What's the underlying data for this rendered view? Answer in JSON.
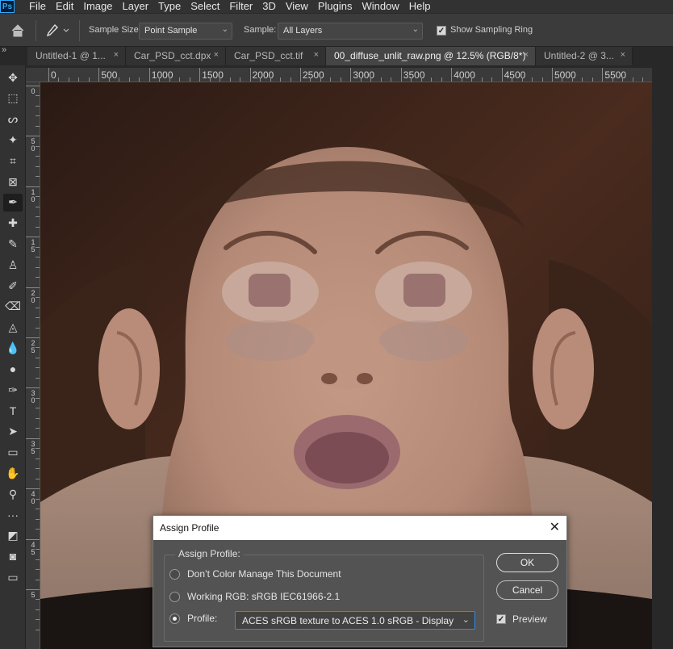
{
  "app": {
    "logo": "Ps"
  },
  "menu": [
    "File",
    "Edit",
    "Image",
    "Layer",
    "Type",
    "Select",
    "Filter",
    "3D",
    "View",
    "Plugins",
    "Window",
    "Help"
  ],
  "options_bar": {
    "home_icon": "home-icon",
    "tool_icon": "eyedropper-icon",
    "sample_size_label": "Sample Size:",
    "sample_size_value": "Point Sample",
    "sample_label": "Sample:",
    "sample_value": "All Layers",
    "show_sampling_ring_label": "Show Sampling Ring",
    "show_sampling_ring_checked": true
  },
  "tabs": [
    {
      "label": "Untitled-1 @ 1...",
      "active": false
    },
    {
      "label": "Car_PSD_cct.dpx",
      "active": false
    },
    {
      "label": "Car_PSD_cct.tif",
      "active": false
    },
    {
      "label": "00_diffuse_unlit_raw.png @ 12.5% (RGB/8*)",
      "active": true
    },
    {
      "label": "Untitled-2 @ 3...",
      "active": false
    }
  ],
  "tab_close_glyph": "×",
  "ruler": {
    "h_labels": [
      "0",
      "500",
      "1000",
      "1500",
      "2000",
      "2500",
      "3000",
      "3500",
      "4000",
      "4500",
      "5000",
      "5500"
    ],
    "v_labels": [
      "0",
      "5 0",
      "1 0",
      "1 5",
      "2 0",
      "2 5",
      "3 0",
      "3 5",
      "4 0",
      "4 5",
      "5"
    ]
  },
  "tools": [
    "move-icon",
    "marquee-icon",
    "lasso-icon",
    "magic-wand-icon",
    "crop-icon",
    "frame-icon",
    "eyedropper-icon",
    "healing-brush-icon",
    "brush-icon",
    "stamp-icon",
    "history-brush-icon",
    "eraser-icon",
    "paint-bucket-icon",
    "blur-icon",
    "dodge-icon",
    "pen-icon",
    "type-icon",
    "path-selection-icon",
    "rectangle-icon",
    "hand-icon",
    "zoom-icon",
    "more-tools-icon",
    "colors-icon",
    "quick-mask-icon",
    "screen-mode-icon"
  ],
  "tool_glyphs": [
    "✥",
    "⬚",
    "ᔕ",
    "✦",
    "⌗",
    "⊠",
    "✒",
    "✚",
    "✎",
    "♙",
    "✐",
    "⌫",
    "◬",
    "💧",
    "●",
    "✑",
    "T",
    "➤",
    "▭",
    "✋",
    "⚲",
    "···",
    "◩",
    "◙",
    "▭"
  ],
  "dialog": {
    "title": "Assign Profile",
    "close_glyph": "✕",
    "group_label": "Assign Profile:",
    "option_dont_manage": "Don’t Color Manage This Document",
    "option_working_rgb": "Working RGB:  sRGB IEC61966-2.1",
    "option_profile": "Profile:",
    "selected_option": "profile",
    "profile_value": "ACES sRGB texture to ACES 1.0 sRGB - Display",
    "ok_label": "OK",
    "cancel_label": "Cancel",
    "preview_label": "Preview",
    "preview_checked": true
  }
}
